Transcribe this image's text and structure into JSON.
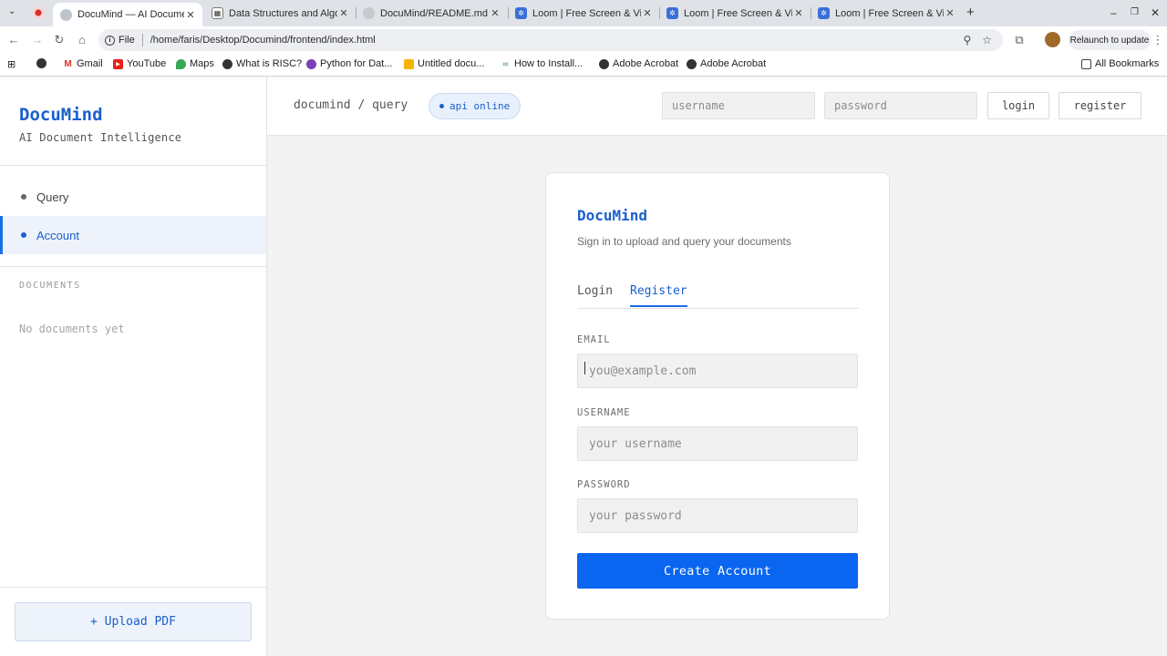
{
  "browser": {
    "tabs": [
      {
        "title": "DocuMind — AI Documen",
        "active": true
      },
      {
        "title": "Data Structures and Algo"
      },
      {
        "title": "DocuMind/README.md a"
      },
      {
        "title": "Loom | Free Screen & Vid"
      },
      {
        "title": "Loom | Free Screen & Vid"
      },
      {
        "title": "Loom | Free Screen & Vid"
      }
    ],
    "new_tab": "+",
    "file_chip": "File",
    "url": "/home/faris/Desktop/Documind/frontend/index.html",
    "relaunch": "Relaunch to update",
    "bookmarks": [
      "Gmail",
      "YouTube",
      "Maps",
      "What is RISC?",
      "Python for Dat...",
      "Untitled docu...",
      "How to Install...",
      "Adobe Acrobat",
      "Adobe Acrobat"
    ],
    "all_bookmarks": "All Bookmarks"
  },
  "sidebar": {
    "brand": "DocuMind",
    "tagline": "AI Document Intelligence",
    "nav": [
      {
        "label": "Query",
        "active": false
      },
      {
        "label": "Account",
        "active": true
      }
    ],
    "documents_heading": "DOCUMENTS",
    "documents_empty": "No documents yet",
    "upload_label": "+ Upload PDF"
  },
  "topbar": {
    "breadcrumb": "documind / query",
    "status": "api online",
    "username_placeholder": "username",
    "password_placeholder": "password",
    "login_label": "login",
    "register_label": "register"
  },
  "auth_card": {
    "title": "DocuMind",
    "subtitle": "Sign in to upload and query your documents",
    "tabs": [
      {
        "label": "Login",
        "active": false
      },
      {
        "label": "Register",
        "active": true
      }
    ],
    "email_label": "EMAIL",
    "email_placeholder": "you@example.com",
    "username_label": "USERNAME",
    "username_placeholder": "your username",
    "password_label": "PASSWORD",
    "password_placeholder": "your password",
    "submit_label": "Create Account"
  },
  "colors": {
    "accent": "#1a5fce",
    "button": "#0a66f0"
  }
}
